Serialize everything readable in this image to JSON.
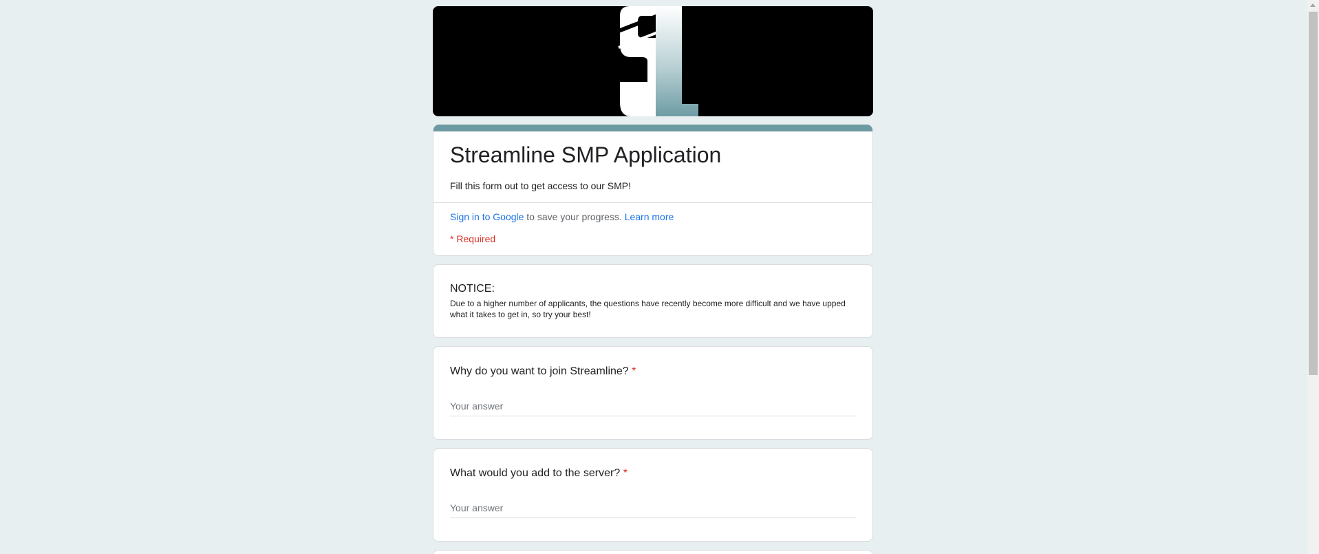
{
  "form": {
    "title": "Streamline SMP Application",
    "description": "Fill this form out to get access to our SMP!",
    "signin_link": "Sign in to Google",
    "signin_text": " to save your progress. ",
    "learn_more": "Learn more",
    "required_note": "* Required"
  },
  "notice": {
    "heading": "NOTICE:",
    "body": "Due to a higher number of applicants, the questions have recently become more difficult and we have upped what it takes to get in, so try your best!"
  },
  "questions": [
    {
      "text": "Why do you want to join Streamline?",
      "required_mark": "*",
      "placeholder": "Your answer"
    },
    {
      "text": "What would you add to the server?",
      "required_mark": "*",
      "placeholder": "Your answer"
    }
  ],
  "theme": {
    "accent": "#6c9aa3",
    "background": "#e8eff1",
    "required_color": "#d93025",
    "link_color": "#1a73e8"
  },
  "banner": {
    "logo_icon": "streamline-sl-logo"
  }
}
